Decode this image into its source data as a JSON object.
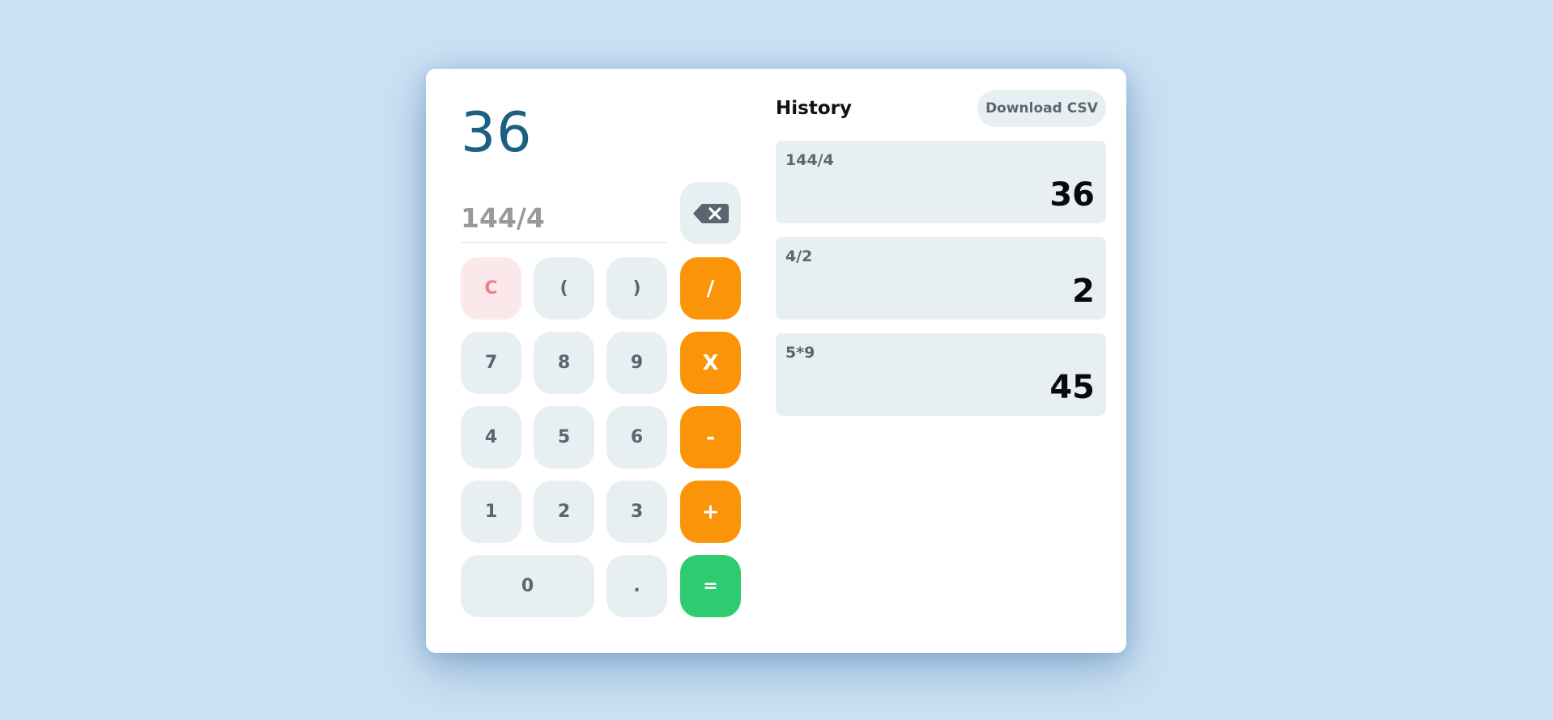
{
  "display": {
    "result": "36",
    "expression": "144/4"
  },
  "keypad": {
    "clear": "C",
    "open_paren": "(",
    "close_paren": ")",
    "divide": "/",
    "seven": "7",
    "eight": "8",
    "nine": "9",
    "multiply": "X",
    "four": "4",
    "five": "5",
    "six": "6",
    "minus": "-",
    "one": "1",
    "two": "2",
    "three": "3",
    "plus": "+",
    "zero": "0",
    "decimal": ".",
    "equals": "=",
    "backspace_icon": "backspace-icon"
  },
  "history": {
    "title": "History",
    "download_label": "Download CSV",
    "items": [
      {
        "expression": "144/4",
        "result": "36"
      },
      {
        "expression": "4/2",
        "result": "2"
      },
      {
        "expression": "5*9",
        "result": "45"
      }
    ]
  },
  "colors": {
    "background": "#cce1f4",
    "result_text": "#1b6082",
    "operator": "#fb9408",
    "equals": "#2ecb71",
    "clear_bg": "#fbe8ea",
    "clear_text": "#f07e88",
    "key_bg": "#e8eff3"
  }
}
